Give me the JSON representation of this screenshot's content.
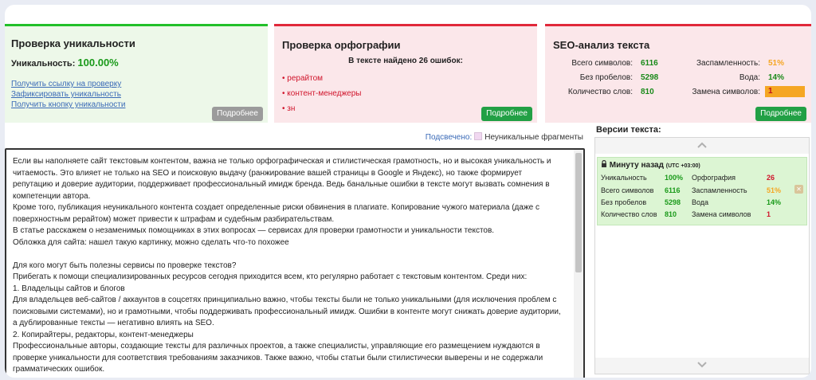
{
  "uniqueness": {
    "title": "Проверка уникальности",
    "label": "Уникальность:",
    "value": "100.00%",
    "links": [
      "Получить ссылку на проверку",
      "Зафиксировать уникальность",
      "Получить кнопку уникальности"
    ],
    "more_button": "Подробнее"
  },
  "spelling": {
    "title": "Проверка орфографии",
    "summary": "В тексте найдено 26 ошибок:",
    "errors": [
      "рерайтом",
      "контент-менеджеры",
      "зн"
    ],
    "more_button": "Подробнее"
  },
  "seo": {
    "title": "SEO-анализ текста",
    "total_chars_label": "Всего символов:",
    "total_chars": "6116",
    "no_spaces_label": "Без пробелов:",
    "no_spaces": "5298",
    "word_count_label": "Количество слов:",
    "word_count": "810",
    "spam_label": "Заспамленность:",
    "spam": "51%",
    "water_label": "Вода:",
    "water": "14%",
    "replace_label": "Замена символов:",
    "replace": "1",
    "more_button": "Подробнее"
  },
  "highlight": {
    "label": "Подсвечено:",
    "legend": "Неуникальные фрагменты"
  },
  "text_lines": [
    "Если вы наполняете сайт текстовым контентом, важна не только орфографическая и стилистическая грамотность, но и высокая уникальность и",
    "читаемость. Это влияет не только на SEO и поисковую выдачу (ранжирование вашей страницы в Google и Яндекс), но также формирует",
    "репутацию и доверие аудитории, поддерживает профессиональный имидж бренда. Ведь банальные ошибки в тексте могут вызвать сомнения в",
    "компетенции автора.",
    "Кроме того, публикация неуникального контента создает определенные риски обвинения в плагиате. Копирование чужого материала (даже с",
    "поверхностным рерайтом) может привести к штрафам и судебным разбирательствам.",
    "В статье расскажем о незаменимых помощниках в этих вопросах — сервисах для проверки грамотности и уникальности текстов.",
    "Обложка для сайта: нашел такую картинку, можно сделать что-то похожее",
    "",
    "Для кого могут быть полезны сервисы по проверке текстов?",
    "Прибегать к помощи специализированных ресурсов сегодня приходится всем, кто регулярно работает с текстовым контентом. Среди них:",
    "1. Владельцы сайтов и блогов",
    "Для владельцев веб-сайтов / аккаунтов в соцсетях принципиально важно, чтобы тексты были не только уникальными (для исключения проблем с",
    "поисковыми системами), но и грамотными, чтобы поддерживать профессиональный имидж. Ошибки в контенте могут снижать доверие аудитории,",
    "а дублированные тексты — негативно влиять на SEO.",
    "2. Копирайтеры, редакторы, контент-менеджеры",
    "Профессиональные авторы, создающие тексты для различных проектов, а также специалисты, управляющие его размещением нуждаются в",
    "проверке уникальности для соответствия требованиям заказчиков. Также важно, чтобы статьи были стилистически выверены и не содержали",
    "грамматических ошибок."
  ],
  "versions": {
    "title": "Версии текста:",
    "entry": {
      "time": "Минуту назад",
      "timezone": "(UTC +03:00)",
      "uniq_label": "Уникальность",
      "uniq": "100%",
      "total_label": "Всего символов",
      "total": "6116",
      "nospace_label": "Без пробелов",
      "nospace": "5298",
      "words_label": "Количество слов",
      "words": "810",
      "spell_label": "Орфография",
      "spell": "26",
      "spam_label": "Заспамленность",
      "spam": "51%",
      "water_label": "Вода",
      "water": "14%",
      "replace_label": "Замена символов",
      "replace": "1"
    }
  },
  "icons": {
    "scroll_up": "chevron-up-icon",
    "scroll_down": "chevron-down-icon",
    "lock": "lock-icon",
    "delete": "close-icon"
  },
  "colors": {
    "green": "#22c02a",
    "red": "#e0283a",
    "orange": "#f5a623",
    "link": "#3a6ab7"
  }
}
